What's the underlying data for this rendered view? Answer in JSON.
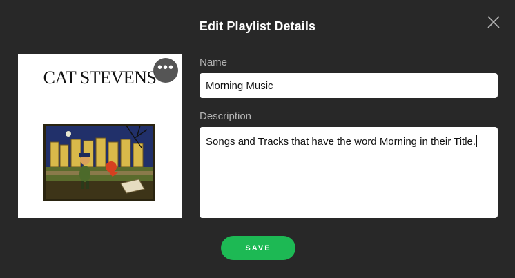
{
  "dialog": {
    "title": "Edit Playlist Details"
  },
  "cover": {
    "artist_text": "CAT STEVENS",
    "more_icon": "ellipsis-icon",
    "more_label": "•••"
  },
  "name_field": {
    "label": "Name",
    "value": "Morning Music"
  },
  "description_field": {
    "label": "Description",
    "value": "Songs and Tracks that have the word Morning in their Title."
  },
  "save_button": {
    "label": "SAVE"
  },
  "colors": {
    "background": "#282828",
    "accent": "#1db954",
    "label": "#b3b3b3"
  }
}
